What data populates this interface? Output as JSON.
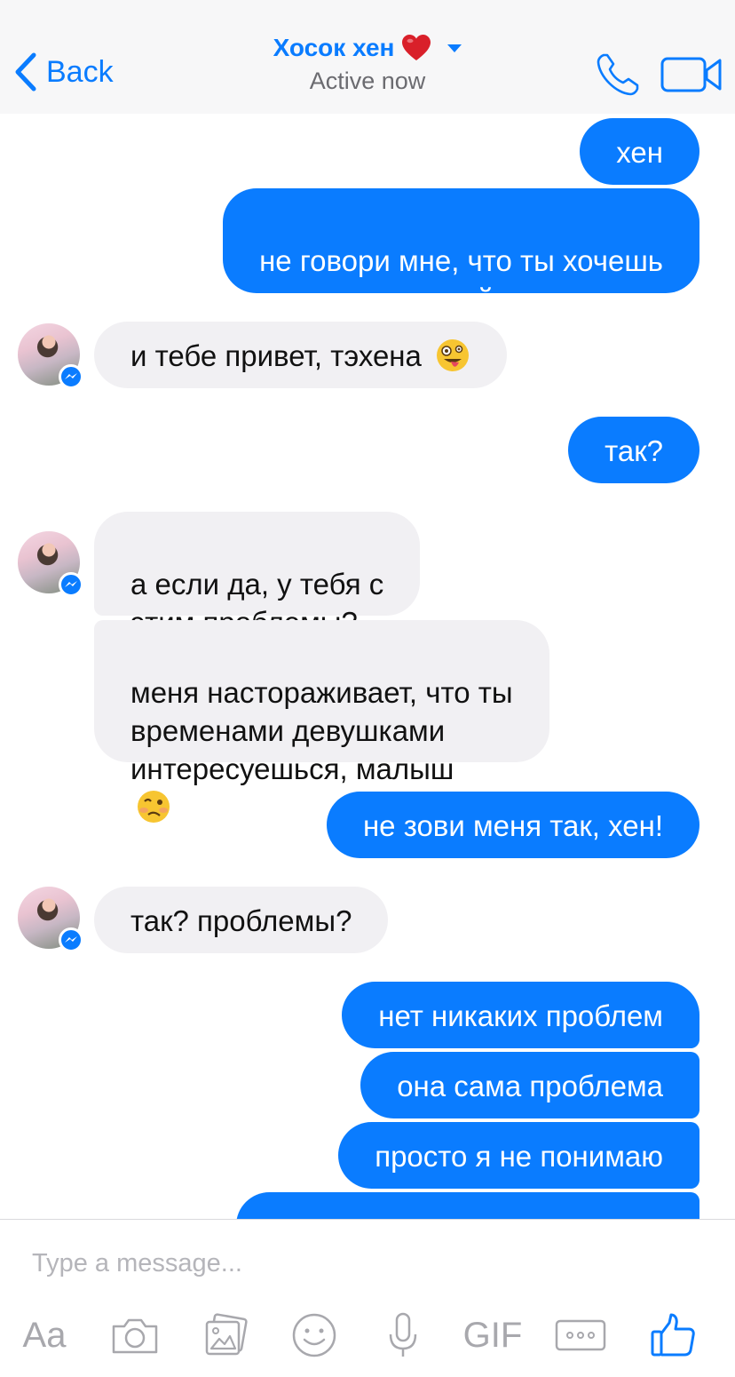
{
  "header": {
    "back_label": "Back",
    "contact_name": "Хосок хен",
    "status": "Active now"
  },
  "messages": [
    {
      "side": "out",
      "text": "хен"
    },
    {
      "side": "out",
      "text": "не говори мне, что ты хочешь\nзамутить с сорой"
    },
    {
      "side": "in",
      "text": "и тебе привет, тэхена",
      "emoji": "zany-face"
    },
    {
      "side": "out",
      "text": "так?"
    },
    {
      "side": "in",
      "text": "а если да, у тебя с\nэтим проблемы?"
    },
    {
      "side": "in",
      "text": "меня настораживает, что ты\nвременами девушками\nинтересуешься, малыш",
      "emoji": "woozy-face"
    },
    {
      "side": "out",
      "text": "не зови меня так, хен!"
    },
    {
      "side": "in",
      "text": "так? проблемы?"
    },
    {
      "side": "out",
      "text": "нет никаких проблем"
    },
    {
      "side": "out",
      "text": "она сама проблема"
    },
    {
      "side": "out",
      "text": "просто я не понимаю"
    }
  ],
  "composer": {
    "placeholder": "Type a message...",
    "tools": {
      "text_label": "Aa",
      "gif_label": "GIF"
    }
  },
  "icons": [
    "chevron-left-icon",
    "heart-icon",
    "phone-icon",
    "video-camera-icon",
    "messenger-badge-icon",
    "camera-icon",
    "gallery-icon",
    "smiley-icon",
    "microphone-icon",
    "more-icon",
    "thumbs-up-icon"
  ],
  "colors": {
    "accent": "#0a7cff",
    "incoming_bubble": "#f1f0f3",
    "heart": "#d9202a"
  }
}
